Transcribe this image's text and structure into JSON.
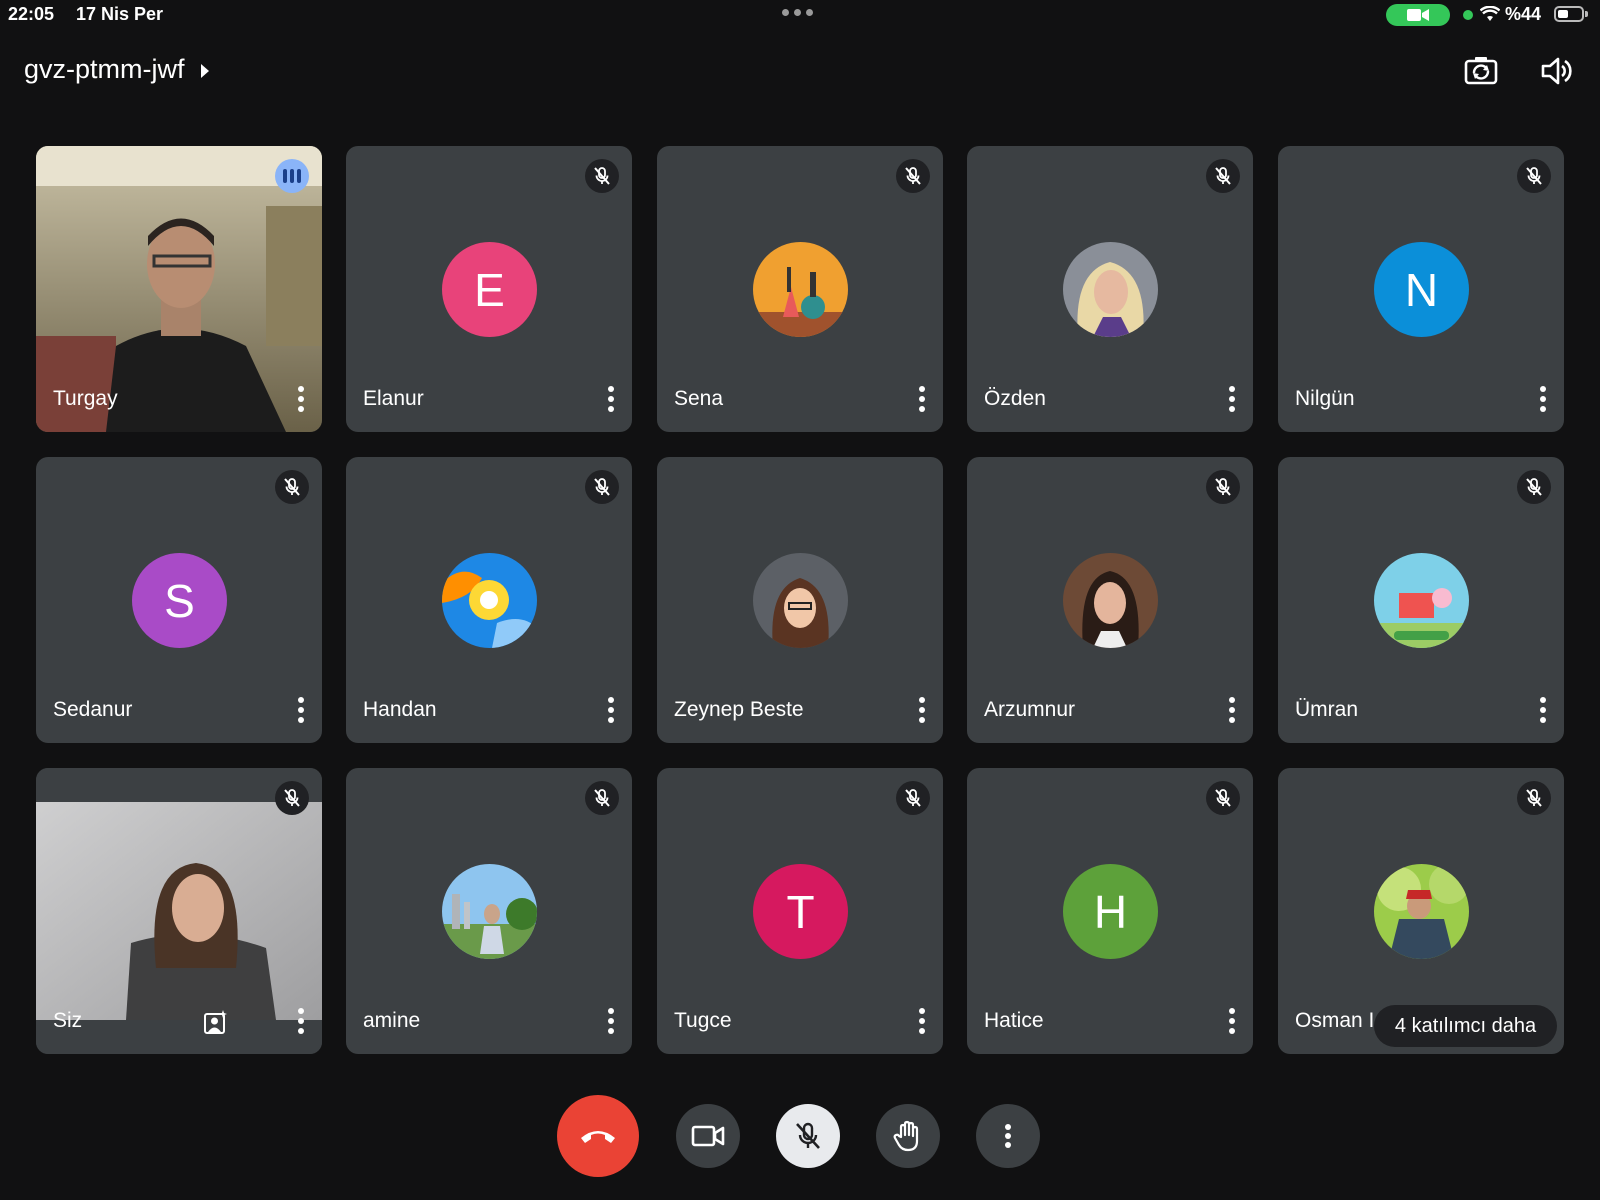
{
  "status_bar": {
    "time": "22:05",
    "date": "17 Nis Per",
    "battery": "%44",
    "battery_level_percent": 44,
    "camera_in_use_color": "#34c759",
    "icons": [
      "camera-icon",
      "wifi-icon",
      "battery-icon",
      "multitasking-dots-icon"
    ]
  },
  "header": {
    "meeting_code": "gvz-ptmm-jwf",
    "icons": [
      "switch-camera-icon",
      "speaker-icon"
    ]
  },
  "tiles": [
    {
      "name": "Turgay",
      "type": "video",
      "speaking": true
    },
    {
      "name": "Elanur",
      "type": "letter",
      "letter": "E",
      "color": "#e8437a",
      "muted": true
    },
    {
      "name": "Sena",
      "type": "photo",
      "muted": true
    },
    {
      "name": "Özden",
      "type": "photo",
      "muted": true
    },
    {
      "name": "Nilgün",
      "type": "letter",
      "letter": "N",
      "color": "#0b8fd9",
      "muted": true
    },
    {
      "name": "Sedanur",
      "type": "letter",
      "letter": "S",
      "color": "#a94bc7",
      "muted": true
    },
    {
      "name": "Handan",
      "type": "photo",
      "muted": true
    },
    {
      "name": "Zeynep Beste",
      "type": "photo",
      "muted": false
    },
    {
      "name": "Arzumnur",
      "type": "photo",
      "muted": true
    },
    {
      "name": "Ümran",
      "type": "photo",
      "muted": true
    },
    {
      "name": "Siz",
      "type": "video",
      "muted": true
    },
    {
      "name": "amine",
      "type": "photo",
      "muted": true
    },
    {
      "name": "Tugce",
      "type": "letter",
      "letter": "T",
      "color": "#d6195f",
      "muted": true
    },
    {
      "name": "Hatice",
      "type": "letter",
      "letter": "H",
      "color": "#5da13a",
      "muted": true
    },
    {
      "name": "Osman I",
      "type": "photo",
      "muted": true
    }
  ],
  "more_participants": "4 katılımcı daha",
  "controls": {
    "end_call_color": "#ea4335",
    "icons": [
      "end-call-icon",
      "camera-icon",
      "microphone-off-icon",
      "raise-hand-icon",
      "more-options-icon"
    ]
  }
}
